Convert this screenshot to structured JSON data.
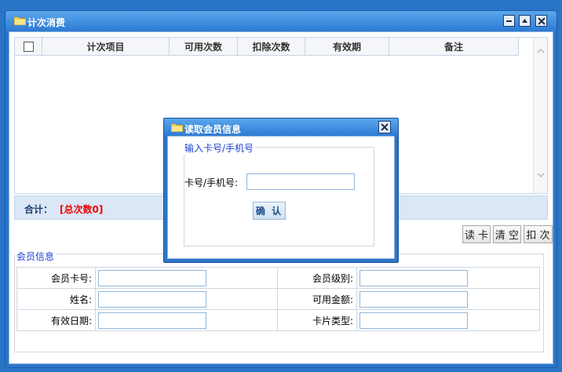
{
  "window": {
    "title": "计次消费"
  },
  "grid": {
    "columns": [
      "计次项目",
      "可用次数",
      "扣除次数",
      "有效期",
      "备注"
    ]
  },
  "summary": {
    "label": "合计：",
    "value": "[总次数0]"
  },
  "actions": {
    "read_card": "读 卡",
    "clear": "清 空",
    "deduct": "扣 次"
  },
  "member": {
    "legend": "会员信息",
    "card_no_label": "会员卡号:",
    "level_label": "会员级别:",
    "name_label": "姓名:",
    "balance_label": "可用金额:",
    "expiry_label": "有效日期:",
    "card_type_label": "卡片类型:"
  },
  "dialog": {
    "title": "读取会员信息",
    "legend": "输入卡号/手机号",
    "field_label": "卡号/手机号:",
    "confirm_label": "确 认"
  },
  "colors": {
    "title_bar": "#2d7ad4",
    "accent_red": "#e00000",
    "legend_blue": "#1e3fd6"
  }
}
